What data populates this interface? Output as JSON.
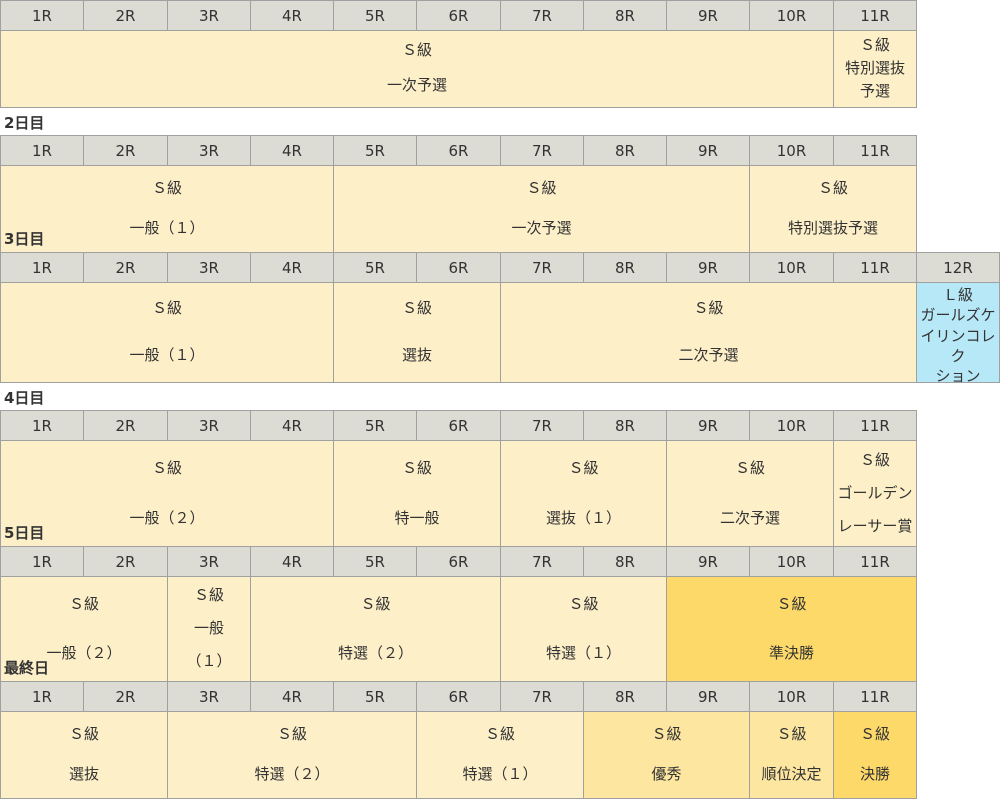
{
  "colors": {
    "header_bg": "#dcdbd4",
    "default": "#fdefc8",
    "light_gold": "#fde6a0",
    "gold": "#fdd96a",
    "blue": "#b7e8f7",
    "border": "#a0a0a0"
  },
  "days": [
    {
      "title": "",
      "races": [
        "1R",
        "2R",
        "3R",
        "4R",
        "5R",
        "6R",
        "7R",
        "8R",
        "9R",
        "10R",
        "11R"
      ],
      "programs": [
        {
          "lines": [
            "Ｓ級",
            "一次予選"
          ]
        },
        {
          "lines": [
            "Ｓ級",
            "特別選抜",
            "予選"
          ]
        }
      ]
    },
    {
      "title": "2日目",
      "races": [
        "1R",
        "2R",
        "3R",
        "4R",
        "5R",
        "6R",
        "7R",
        "8R",
        "9R",
        "10R",
        "11R"
      ],
      "programs": [
        {
          "lines": [
            "Ｓ級",
            "一般（１）"
          ]
        },
        {
          "lines": [
            "Ｓ級",
            "一次予選"
          ]
        },
        {
          "lines": [
            "Ｓ級",
            "特別選抜予選"
          ]
        }
      ]
    },
    {
      "title": "3日目",
      "races": [
        "1R",
        "2R",
        "3R",
        "4R",
        "5R",
        "6R",
        "7R",
        "8R",
        "9R",
        "10R",
        "11R",
        "12R"
      ],
      "programs": [
        {
          "lines": [
            "Ｓ級",
            "一般（１）"
          ]
        },
        {
          "lines": [
            "Ｓ級",
            "選抜"
          ]
        },
        {
          "lines": [
            "Ｓ級",
            "二次予選"
          ]
        },
        {
          "lines": [
            "Ｌ級",
            "ガールズケ",
            "イリンコレク",
            "ション"
          ]
        }
      ]
    },
    {
      "title": "4日目",
      "races": [
        "1R",
        "2R",
        "3R",
        "4R",
        "5R",
        "6R",
        "7R",
        "8R",
        "9R",
        "10R",
        "11R"
      ],
      "programs": [
        {
          "lines": [
            "Ｓ級",
            "一般（２）"
          ]
        },
        {
          "lines": [
            "Ｓ級",
            "特一般"
          ]
        },
        {
          "lines": [
            "Ｓ級",
            "選抜（１）"
          ]
        },
        {
          "lines": [
            "Ｓ級",
            "二次予選"
          ]
        },
        {
          "lines": [
            "Ｓ級",
            "ゴールデン",
            "レーサー賞"
          ]
        }
      ]
    },
    {
      "title": "5日目",
      "races": [
        "1R",
        "2R",
        "3R",
        "4R",
        "5R",
        "6R",
        "7R",
        "8R",
        "9R",
        "10R",
        "11R"
      ],
      "programs": [
        {
          "lines": [
            "Ｓ級",
            "一般（２）"
          ]
        },
        {
          "lines": [
            "Ｓ級",
            "一般",
            "（１）"
          ]
        },
        {
          "lines": [
            "Ｓ級",
            "特選（２）"
          ]
        },
        {
          "lines": [
            "Ｓ級",
            "特選（１）"
          ]
        },
        {
          "lines": [
            "Ｓ級",
            "準決勝"
          ]
        }
      ]
    },
    {
      "title": "最終日",
      "races": [
        "1R",
        "2R",
        "3R",
        "4R",
        "5R",
        "6R",
        "7R",
        "8R",
        "9R",
        "10R",
        "11R"
      ],
      "programs": [
        {
          "lines": [
            "Ｓ級",
            "選抜"
          ]
        },
        {
          "lines": [
            "Ｓ級",
            "特選（２）"
          ]
        },
        {
          "lines": [
            "Ｓ級",
            "特選（１）"
          ]
        },
        {
          "lines": [
            "Ｓ級",
            "優秀"
          ]
        },
        {
          "lines": [
            "Ｓ級",
            "順位決定"
          ]
        },
        {
          "lines": [
            "Ｓ級",
            "決勝"
          ]
        }
      ]
    }
  ]
}
